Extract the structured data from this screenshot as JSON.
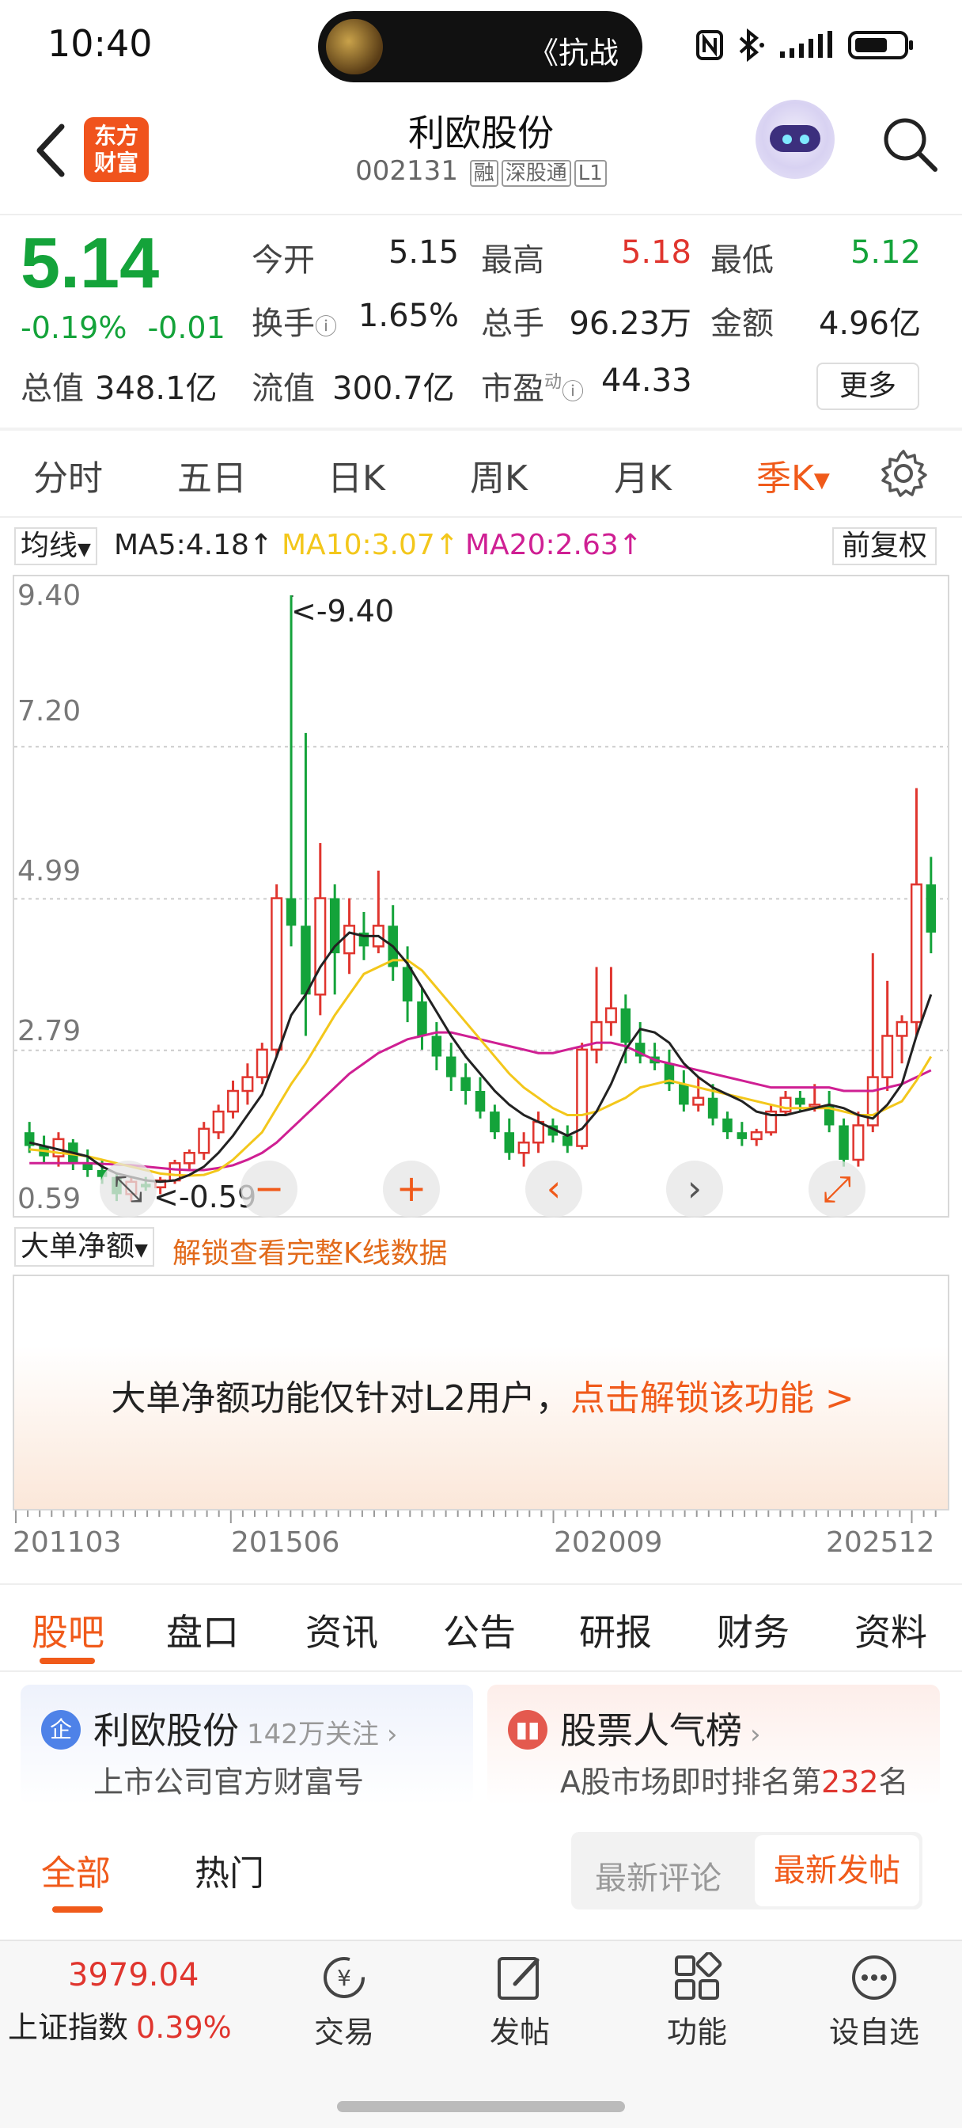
{
  "status": {
    "time": "10:40",
    "pill_text": "《抗战"
  },
  "header": {
    "logo_text": "东方财富",
    "title": "利欧股份",
    "code": "002131",
    "tags": [
      "融",
      "深股通",
      "L1"
    ]
  },
  "quote": {
    "price": "5.14",
    "change_pct": "-0.19%",
    "change_abs": "-0.01",
    "open_label": "今开",
    "open": "5.15",
    "high_label": "最高",
    "high": "5.18",
    "low_label": "最低",
    "low": "5.12",
    "turnover_label": "换手",
    "turnover": "1.65%",
    "volume_label": "总手",
    "volume": "96.23万",
    "amount_label": "金额",
    "amount": "4.96亿",
    "mcap_label": "总值",
    "mcap": "348.1亿",
    "float_label": "流值",
    "float": "300.7亿",
    "pe_label": "市盈",
    "pe_sup": "动",
    "pe": "44.33",
    "more": "更多"
  },
  "period_tabs": [
    "分时",
    "五日",
    "日K",
    "周K",
    "月K",
    "季K"
  ],
  "active_period": "季K",
  "ma": {
    "selector": "均线",
    "ma5": "MA5:4.18↑",
    "ma10": "MA10:3.07↑",
    "ma20": "MA20:2.63↑",
    "adjust": "前复权",
    "colors": {
      "ma5": "#222222",
      "ma10": "#f3c71b",
      "ma20": "#cf1f93"
    }
  },
  "chart_data": {
    "type": "candlestick",
    "y_tick_labels": [
      "9.40",
      "7.20",
      "4.99",
      "2.79",
      "0.59"
    ],
    "ylim": [
      0.59,
      9.4
    ],
    "max_label": "<-9.40",
    "min_label": "<-0.59",
    "x_tick_labels": [
      "201103",
      "201506",
      "202009",
      "202512"
    ],
    "ohlc": [
      [
        1.6,
        1.75,
        1.3,
        1.4
      ],
      [
        1.4,
        1.55,
        1.15,
        1.25
      ],
      [
        1.25,
        1.6,
        1.1,
        1.5
      ],
      [
        1.45,
        1.5,
        1.05,
        1.15
      ],
      [
        1.15,
        1.35,
        0.95,
        1.05
      ],
      [
        1.05,
        1.2,
        0.85,
        0.95
      ],
      [
        0.95,
        1.0,
        0.6,
        0.7
      ],
      [
        0.7,
        0.95,
        0.59,
        0.88
      ],
      [
        0.85,
        0.95,
        0.75,
        0.8
      ],
      [
        0.8,
        0.95,
        0.7,
        0.9
      ],
      [
        0.9,
        1.2,
        0.85,
        1.15
      ],
      [
        1.15,
        1.35,
        1.05,
        1.3
      ],
      [
        1.3,
        1.75,
        1.2,
        1.65
      ],
      [
        1.6,
        2.0,
        1.5,
        1.9
      ],
      [
        1.9,
        2.35,
        1.8,
        2.2
      ],
      [
        2.2,
        2.6,
        2.0,
        2.4
      ],
      [
        2.4,
        2.9,
        2.3,
        2.8
      ],
      [
        2.8,
        5.2,
        2.7,
        5.0
      ],
      [
        5.0,
        9.4,
        4.3,
        4.6
      ],
      [
        4.6,
        7.4,
        3.0,
        3.6
      ],
      [
        3.6,
        5.8,
        3.3,
        5.0
      ],
      [
        5.0,
        5.2,
        3.6,
        4.2
      ],
      [
        4.2,
        5.0,
        3.9,
        4.6
      ],
      [
        4.5,
        4.8,
        4.1,
        4.3
      ],
      [
        4.3,
        5.4,
        4.2,
        4.6
      ],
      [
        4.6,
        4.9,
        3.8,
        4.0
      ],
      [
        4.0,
        4.3,
        3.2,
        3.5
      ],
      [
        3.5,
        3.7,
        2.8,
        3.0
      ],
      [
        3.0,
        3.2,
        2.5,
        2.7
      ],
      [
        2.7,
        2.9,
        2.2,
        2.4
      ],
      [
        2.4,
        2.6,
        2.0,
        2.2
      ],
      [
        2.2,
        2.4,
        1.8,
        1.9
      ],
      [
        1.9,
        2.0,
        1.5,
        1.6
      ],
      [
        1.6,
        1.8,
        1.2,
        1.3
      ],
      [
        1.3,
        1.6,
        1.1,
        1.45
      ],
      [
        1.45,
        1.9,
        1.3,
        1.75
      ],
      [
        1.7,
        1.8,
        1.45,
        1.55
      ],
      [
        1.55,
        1.7,
        1.3,
        1.4
      ],
      [
        1.4,
        2.9,
        1.35,
        2.8
      ],
      [
        2.8,
        4.0,
        2.6,
        3.2
      ],
      [
        3.2,
        4.0,
        3.0,
        3.4
      ],
      [
        3.4,
        3.6,
        2.6,
        2.9
      ],
      [
        2.9,
        3.2,
        2.6,
        2.7
      ],
      [
        2.7,
        2.9,
        2.5,
        2.6
      ],
      [
        2.6,
        2.8,
        2.2,
        2.3
      ],
      [
        2.3,
        2.5,
        1.9,
        2.0
      ],
      [
        2.0,
        2.4,
        1.9,
        2.1
      ],
      [
        2.1,
        2.3,
        1.7,
        1.8
      ],
      [
        1.8,
        1.9,
        1.5,
        1.6
      ],
      [
        1.6,
        1.75,
        1.4,
        1.5
      ],
      [
        1.5,
        1.65,
        1.4,
        1.6
      ],
      [
        1.6,
        2.0,
        1.55,
        1.9
      ],
      [
        1.9,
        2.2,
        1.85,
        2.1
      ],
      [
        2.1,
        2.2,
        1.9,
        2.0
      ],
      [
        2.0,
        2.3,
        1.9,
        2.0
      ],
      [
        2.0,
        2.2,
        1.6,
        1.7
      ],
      [
        1.7,
        1.8,
        1.1,
        1.2
      ],
      [
        1.2,
        1.9,
        1.1,
        1.7
      ],
      [
        1.7,
        4.2,
        1.6,
        2.4
      ],
      [
        2.4,
        3.8,
        2.2,
        3.0
      ],
      [
        3.0,
        3.3,
        2.6,
        3.2
      ],
      [
        3.2,
        6.6,
        3.0,
        5.2
      ],
      [
        5.2,
        5.6,
        4.2,
        4.5
      ]
    ],
    "ma5": [
      1.45,
      1.4,
      1.35,
      1.3,
      1.25,
      1.1,
      1.0,
      0.95,
      0.9,
      0.88,
      0.9,
      0.98,
      1.1,
      1.3,
      1.55,
      1.85,
      2.15,
      2.7,
      3.3,
      3.6,
      4.0,
      4.3,
      4.5,
      4.45,
      4.45,
      4.3,
      4.05,
      3.7,
      3.35,
      3.0,
      2.7,
      2.45,
      2.2,
      2.0,
      1.85,
      1.75,
      1.65,
      1.55,
      1.65,
      1.9,
      2.3,
      2.8,
      3.1,
      3.05,
      2.9,
      2.6,
      2.4,
      2.25,
      2.15,
      2.05,
      1.9,
      1.85,
      1.85,
      1.9,
      1.95,
      2.0,
      1.95,
      1.85,
      1.8,
      2.0,
      2.3,
      3.0,
      3.6
    ],
    "ma10": [
      1.35,
      1.33,
      1.3,
      1.28,
      1.25,
      1.2,
      1.15,
      1.1,
      1.05,
      1.0,
      0.98,
      0.97,
      0.98,
      1.05,
      1.2,
      1.4,
      1.6,
      1.95,
      2.3,
      2.6,
      2.95,
      3.3,
      3.6,
      3.9,
      4.0,
      4.1,
      4.1,
      3.95,
      3.7,
      3.45,
      3.2,
      2.95,
      2.7,
      2.45,
      2.25,
      2.1,
      1.95,
      1.85,
      1.85,
      1.9,
      2.0,
      2.1,
      2.25,
      2.3,
      2.35,
      2.3,
      2.25,
      2.2,
      2.15,
      2.1,
      2.05,
      2.0,
      1.95,
      1.95,
      1.95,
      1.95,
      1.9,
      1.85,
      1.85,
      1.95,
      2.05,
      2.35,
      2.7
    ],
    "ma20": [
      1.15,
      1.15,
      1.15,
      1.15,
      1.15,
      1.14,
      1.13,
      1.12,
      1.1,
      1.08,
      1.06,
      1.05,
      1.05,
      1.08,
      1.12,
      1.2,
      1.3,
      1.45,
      1.65,
      1.85,
      2.05,
      2.25,
      2.45,
      2.6,
      2.75,
      2.85,
      2.95,
      3.0,
      3.05,
      3.05,
      3.0,
      2.95,
      2.9,
      2.85,
      2.8,
      2.75,
      2.75,
      2.8,
      2.85,
      2.9,
      2.9,
      2.85,
      2.75,
      2.65,
      2.6,
      2.55,
      2.5,
      2.45,
      2.4,
      2.35,
      2.3,
      2.25,
      2.25,
      2.25,
      2.25,
      2.25,
      2.2,
      2.2,
      2.2,
      2.25,
      2.3,
      2.4,
      2.5
    ],
    "up_color": "#e0352e",
    "down_color": "#14a33a"
  },
  "chart_controls": [
    "−",
    "+",
    "‹",
    "›",
    "⤢"
  ],
  "big_order": {
    "selector": "大单净额",
    "unlock_link": "解锁查看完整K线数据",
    "message": "大单净额功能仅针对L2用户，",
    "message_link": "点击解锁该功能 >"
  },
  "section_tabs": [
    "股吧",
    "盘口",
    "资讯",
    "公告",
    "研报",
    "财务",
    "资料"
  ],
  "cards": {
    "official": {
      "icon": "企",
      "title": "利欧股份",
      "followers": "142万关注",
      "subtitle": "上市公司官方财富号"
    },
    "popularity": {
      "title": "股票人气榜",
      "subtitle_prefix": "A股市场即时排名第",
      "rank": "232",
      "subtitle_suffix": "名"
    }
  },
  "filter": {
    "all": "全部",
    "hot": "热门",
    "latest_comment": "最新评论",
    "latest_post": "最新发帖"
  },
  "bottom_bar": {
    "index_value": "3979.04",
    "index_name": "上证指数",
    "index_change": "0.39%",
    "trade": "交易",
    "post": "发帖",
    "functions": "功能",
    "watchlist": "设自选"
  }
}
